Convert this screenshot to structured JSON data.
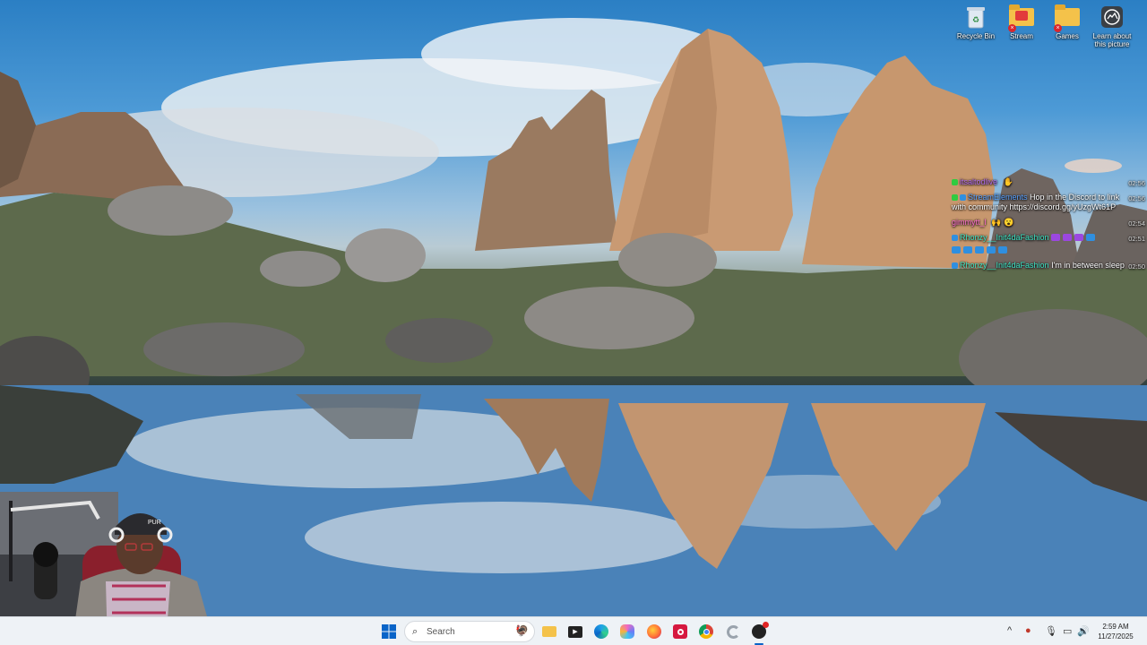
{
  "desktop": {
    "icons": [
      {
        "label": "Recycle Bin"
      },
      {
        "label": "Stream"
      },
      {
        "label": "Games"
      },
      {
        "label": "Learn about this picture"
      }
    ]
  },
  "chat": {
    "messages": [
      {
        "user": "itsaltodlive",
        "text": "",
        "time": "02:56",
        "user_color": "#b06cf0"
      },
      {
        "user": "StreamElements",
        "text": "Hop in the Discord to link with community https://discord.gg/yUzgWt61P",
        "time": "02:56",
        "user_color": "#5aa2ff"
      },
      {
        "user": "gimmytt_l",
        "text": "",
        "time": "02:54",
        "user_color": "#ff6fd1"
      },
      {
        "user": "Rhonzy__Init4daFashion",
        "text": "",
        "time": "02:51",
        "user_color": "#3ee7c7"
      },
      {
        "user": "Rhonzy__Init4daFashion",
        "text": "I'm in between sleep",
        "time": "02:50",
        "user_color": "#3ee7c7"
      }
    ]
  },
  "taskbar": {
    "search_placeholder": "Search",
    "apps": [
      "start-icon",
      "file-explorer-icon",
      "media-player-icon",
      "edge-icon",
      "copilot-icon",
      "firefox-icon",
      "app-red-icon",
      "chrome-icon",
      "refresh-icon",
      "obs-icon"
    ],
    "tray": {
      "chevron": "^",
      "clock_time": "2:59 AM",
      "clock_date": "11/27/2025"
    }
  },
  "colors": {
    "taskbar_bg": "#eef2f6",
    "accent": "#0a64c8"
  }
}
